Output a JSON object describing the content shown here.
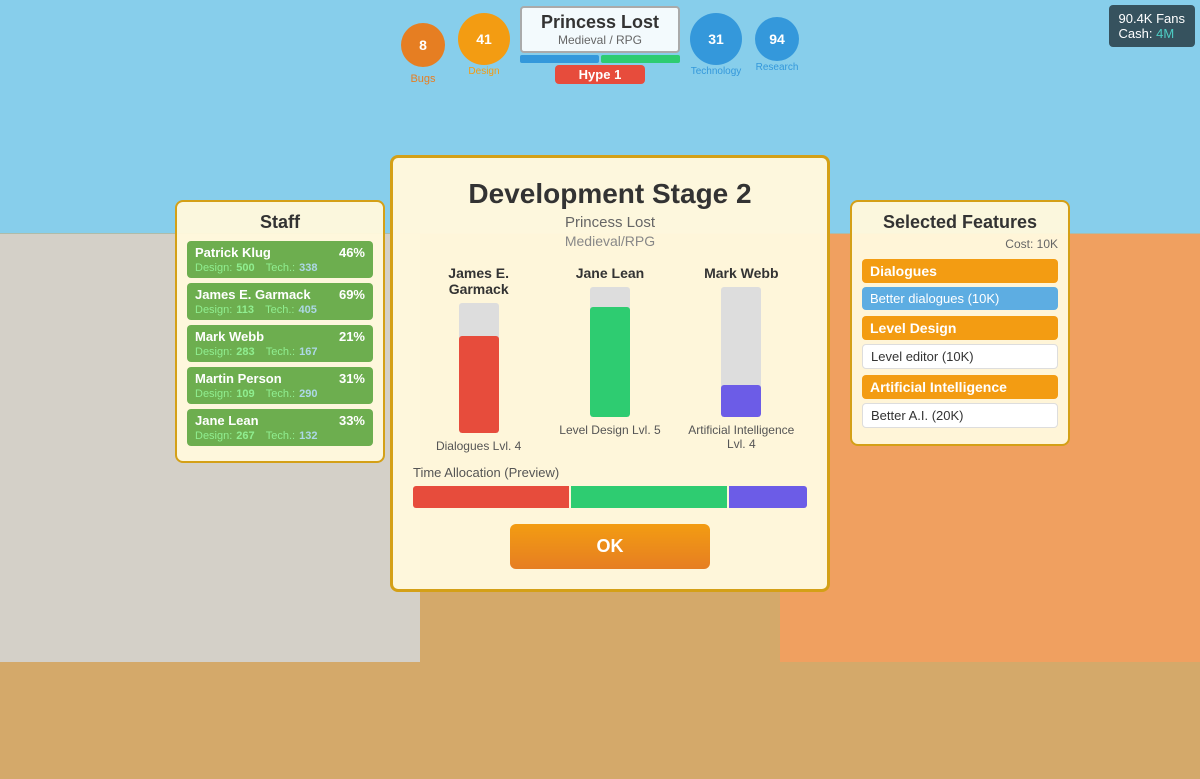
{
  "topBar": {
    "bugs": "8",
    "bugsLabel": "Bugs",
    "design": "41",
    "designLabel": "Design",
    "gameTitle": "Princess Lost",
    "gameGenre": "Medieval / RPG",
    "hype": "Hype 1",
    "technology": "31",
    "technologyLabel": "Technology",
    "research": "94",
    "researchLabel": "Research"
  },
  "topRight": {
    "fans": "90.4K Fans",
    "cashLabel": "Cash:",
    "cashValue": "4M"
  },
  "staffPanel": {
    "title": "Staff",
    "workers": [
      {
        "name": "Patrick Klug",
        "percent": "46%",
        "designLabel": "Design:",
        "designValue": "500",
        "techLabel": "Tech.:",
        "techValue": "338"
      },
      {
        "name": "James E. Garmack",
        "percent": "69%",
        "designLabel": "Design:",
        "designValue": "113",
        "techLabel": "Tech.:",
        "techValue": "405"
      },
      {
        "name": "Mark Webb",
        "percent": "21%",
        "designLabel": "Design:",
        "designValue": "283",
        "techLabel": "Tech.:",
        "techValue": "167"
      },
      {
        "name": "Martin Person",
        "percent": "31%",
        "designLabel": "Design:",
        "designValue": "109",
        "techLabel": "Tech.:",
        "techValue": "290"
      },
      {
        "name": "Jane Lean",
        "percent": "33%",
        "designLabel": "Design:",
        "designValue": "267",
        "techLabel": "Tech.:",
        "techValue": "132"
      }
    ]
  },
  "devDialog": {
    "title": "Development Stage 2",
    "gameName": "Princess Lost",
    "gameGenre": "Medieval/RPG",
    "workers": [
      {
        "name": "James E. Garmack",
        "taskLabel": "Dialogues Lvl. 4",
        "barColor": "red"
      },
      {
        "name": "Jane Lean",
        "taskLabel": "Level Design Lvl. 5",
        "barColor": "green"
      },
      {
        "name": "Mark Webb",
        "taskLabel": "Artificial Intelligence Lvl. 4",
        "barColor": "blue"
      }
    ],
    "timeAllocationLabel": "Time Allocation (Preview)",
    "okButton": "OK"
  },
  "featuresPanel": {
    "title": "Selected Features",
    "costLabel": "Cost: 10K",
    "categories": [
      {
        "name": "Dialogues",
        "selectedFeature": "Better dialogues (10K)",
        "selectedHighlight": true
      },
      {
        "name": "Level Design",
        "selectedFeature": "Level editor (10K)",
        "selectedHighlight": false
      },
      {
        "name": "Artificial Intelligence",
        "selectedFeature": "Better A.I. (20K)",
        "selectedHighlight": false
      }
    ]
  }
}
